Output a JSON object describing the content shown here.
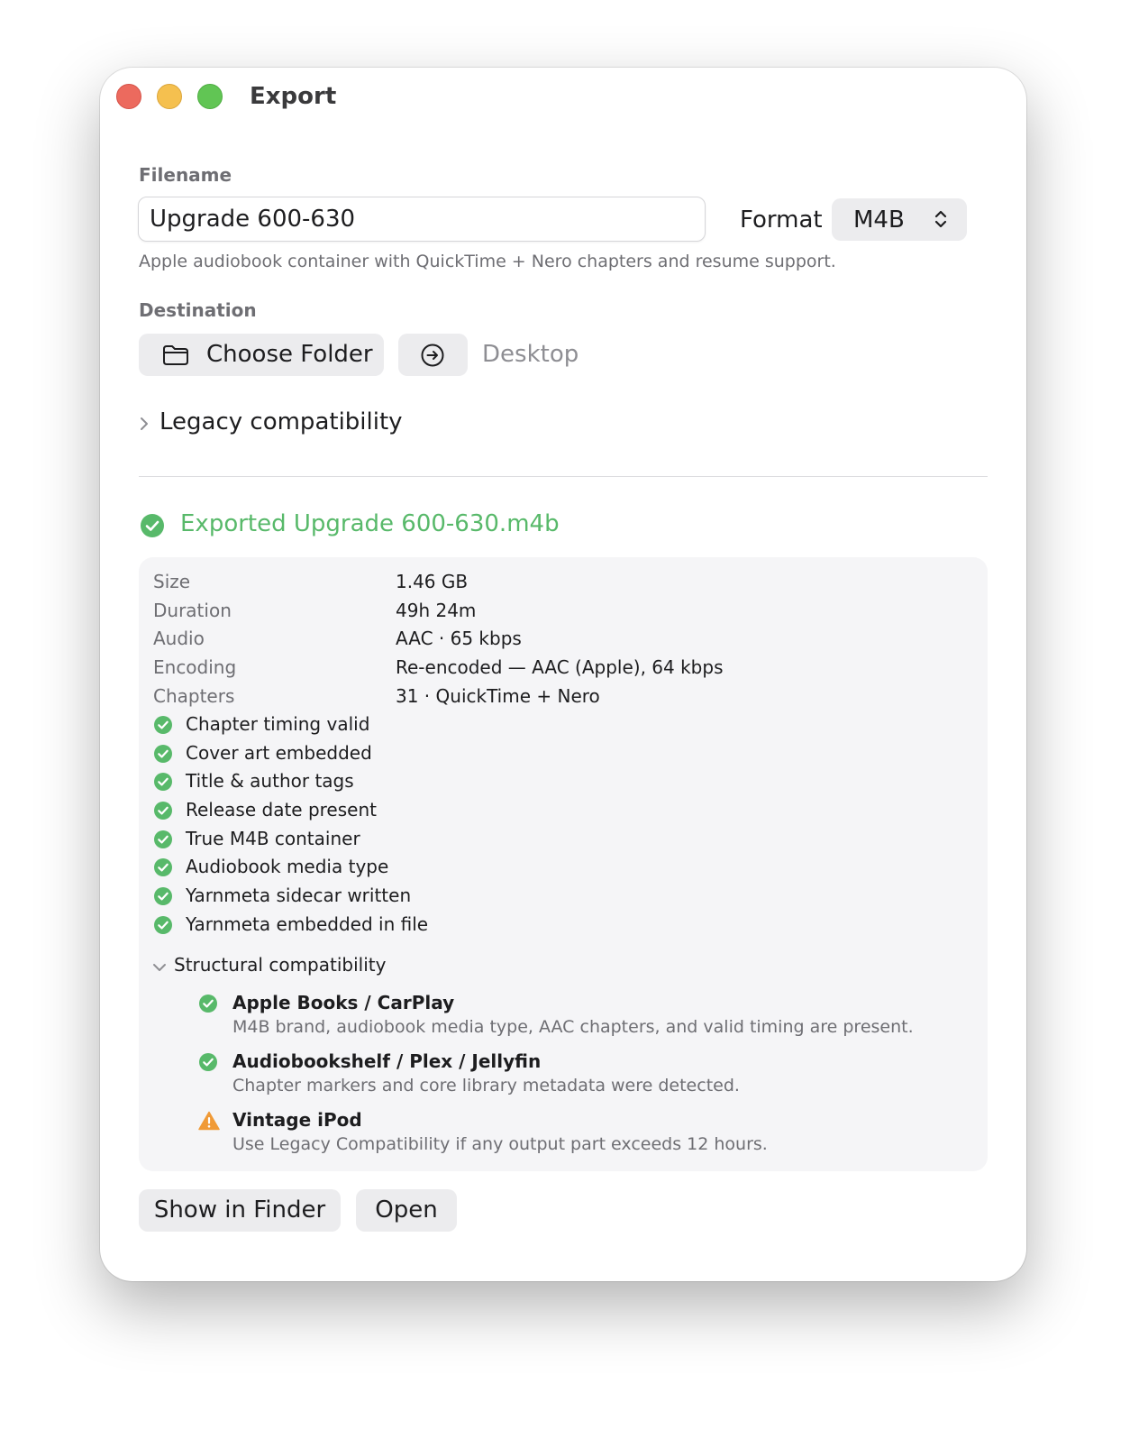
{
  "window": {
    "title": "Export"
  },
  "filename": {
    "label": "Filename",
    "value": "Upgrade 600-630"
  },
  "format": {
    "label": "Format",
    "selected": "M4B",
    "hint": "Apple audiobook container with QuickTime + Nero chapters and resume support."
  },
  "destination": {
    "label": "Destination",
    "choose_label": "Choose Folder",
    "path": "Desktop"
  },
  "legacy": {
    "label": "Legacy compatibility",
    "expanded": false
  },
  "result": {
    "title": "Exported Upgrade 600-630.m4b",
    "status": "success",
    "details": [
      {
        "key": "Size",
        "value": "1.46 GB"
      },
      {
        "key": "Duration",
        "value": "49h 24m"
      },
      {
        "key": "Audio",
        "value": "AAC · 65 kbps"
      },
      {
        "key": "Encoding",
        "value": "Re-encoded — AAC (Apple), 64 kbps"
      },
      {
        "key": "Chapters",
        "value": "31 · QuickTime + Nero"
      }
    ],
    "checks": [
      "Chapter timing valid",
      "Cover art embedded",
      "Title & author tags",
      "Release date present",
      "True M4B container",
      "Audiobook media type",
      "Yarnmeta sidecar written",
      "Yarnmeta embedded in file"
    ],
    "structural": {
      "label": "Structural compatibility",
      "expanded": true,
      "items": [
        {
          "name": "Apple Books / CarPlay",
          "status": "ok",
          "desc": "M4B brand, audiobook media type, AAC chapters, and valid timing are present."
        },
        {
          "name": "Audiobookshelf / Plex / Jellyfin",
          "status": "ok",
          "desc": "Chapter markers and core library metadata were detected."
        },
        {
          "name": "Vintage iPod",
          "status": "warning",
          "desc": "Use Legacy Compatibility if any output part exceeds 12 hours."
        }
      ]
    }
  },
  "actions": {
    "show_in_finder": "Show in Finder",
    "open": "Open"
  },
  "colors": {
    "success": "#58b96a",
    "warning": "#f09a37",
    "close": "#ec6a5e",
    "minimize": "#f5c04f",
    "zoom": "#61c554",
    "button_bg": "#ececee",
    "panel_bg": "#f5f5f7"
  },
  "icons": {
    "choose_folder": "folder-icon",
    "reveal": "arrow-circle-right-icon",
    "legacy": "chevron-right-icon",
    "structural": "chevron-down-icon",
    "format": "updown-chevron-icon",
    "success": "checkmark-circle-icon",
    "warning": "warning-triangle-icon"
  }
}
